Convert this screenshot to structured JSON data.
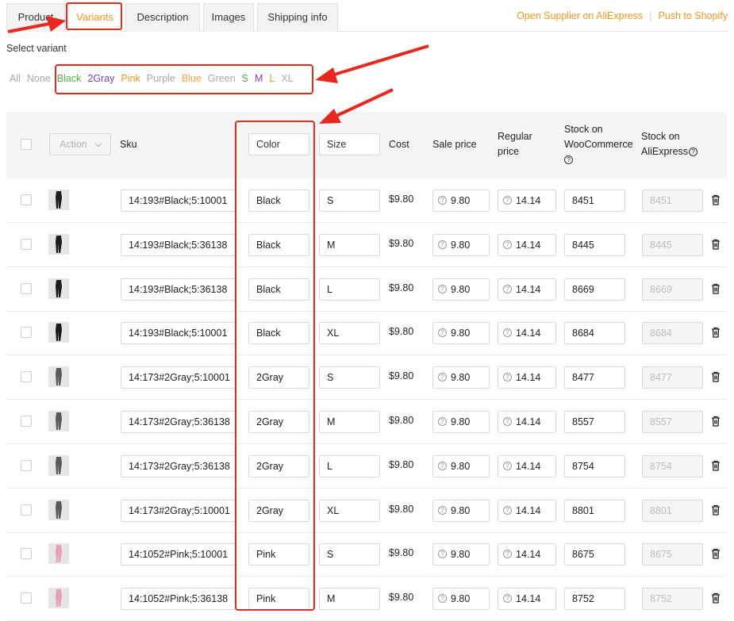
{
  "tabs": [
    {
      "label": "Product",
      "active": false
    },
    {
      "label": "Variants",
      "active": true
    },
    {
      "label": "Description",
      "active": false
    },
    {
      "label": "Images",
      "active": false
    },
    {
      "label": "Shipping info",
      "active": false
    }
  ],
  "header_links": {
    "open_supplier": "Open Supplier on AliExpress",
    "push": "Push to Shopify"
  },
  "select_variant_label": "Select variant",
  "filters": [
    {
      "label": "All",
      "color": "#a8a8a8"
    },
    {
      "label": "None",
      "color": "#a8a8a8"
    },
    {
      "label": "Black",
      "color": "#52b043"
    },
    {
      "label": "2Gray",
      "color": "#7b3fc4"
    },
    {
      "label": "Pink",
      "color": "#f0961e"
    },
    {
      "label": "Purple",
      "color": "#a8a8a8"
    },
    {
      "label": "Blue",
      "color": "#f0a83c"
    },
    {
      "label": "Green",
      "color": "#a8a8a8"
    },
    {
      "label": "S",
      "color": "#52b043"
    },
    {
      "label": "M",
      "color": "#7b3fc4"
    },
    {
      "label": "L",
      "color": "#f0961e"
    },
    {
      "label": "XL",
      "color": "#a8a8a8"
    }
  ],
  "table": {
    "action_label": "Action",
    "headers": {
      "sku": "Sku",
      "color": "Color",
      "size": "Size",
      "cost": "Cost",
      "sale_price": "Sale price",
      "regular_price_1": "Regular",
      "regular_price_2": "price",
      "stock_woo_1": "Stock on",
      "stock_woo_2": "WooCommerce",
      "stock_ali_1": "Stock on",
      "stock_ali_2": "AliExpress"
    },
    "rows": [
      {
        "sku": "14:193#Black;5:10001",
        "color": "Black",
        "size": "S",
        "cost": "$9.80",
        "sale": "9.80",
        "regular": "14.14",
        "stock_woo": "8451",
        "stock_ali": "8451",
        "thumb": "black"
      },
      {
        "sku": "14:193#Black;5:36138",
        "color": "Black",
        "size": "M",
        "cost": "$9.80",
        "sale": "9.80",
        "regular": "14.14",
        "stock_woo": "8445",
        "stock_ali": "8445",
        "thumb": "black"
      },
      {
        "sku": "14:193#Black;5:36138",
        "color": "Black",
        "size": "L",
        "cost": "$9.80",
        "sale": "9.80",
        "regular": "14.14",
        "stock_woo": "8669",
        "stock_ali": "8669",
        "thumb": "black"
      },
      {
        "sku": "14:193#Black;5:10001",
        "color": "Black",
        "size": "XL",
        "cost": "$9.80",
        "sale": "9.80",
        "regular": "14.14",
        "stock_woo": "8684",
        "stock_ali": "8684",
        "thumb": "black"
      },
      {
        "sku": "14:173#2Gray;5:10001",
        "color": "2Gray",
        "size": "S",
        "cost": "$9.80",
        "sale": "9.80",
        "regular": "14.14",
        "stock_woo": "8477",
        "stock_ali": "8477",
        "thumb": "gray"
      },
      {
        "sku": "14:173#2Gray;5:36138",
        "color": "2Gray",
        "size": "M",
        "cost": "$9.80",
        "sale": "9.80",
        "regular": "14.14",
        "stock_woo": "8557",
        "stock_ali": "8557",
        "thumb": "gray"
      },
      {
        "sku": "14:173#2Gray;5:36138",
        "color": "2Gray",
        "size": "L",
        "cost": "$9.80",
        "sale": "9.80",
        "regular": "14.14",
        "stock_woo": "8754",
        "stock_ali": "8754",
        "thumb": "gray"
      },
      {
        "sku": "14:173#2Gray;5:10001",
        "color": "2Gray",
        "size": "XL",
        "cost": "$9.80",
        "sale": "9.80",
        "regular": "14.14",
        "stock_woo": "8801",
        "stock_ali": "8801",
        "thumb": "gray"
      },
      {
        "sku": "14:1052#Pink;5:10001",
        "color": "Pink",
        "size": "S",
        "cost": "$9.80",
        "sale": "9.80",
        "regular": "14.14",
        "stock_woo": "8675",
        "stock_ali": "8675",
        "thumb": "pink"
      },
      {
        "sku": "14:1052#Pink;5:36138",
        "color": "Pink",
        "size": "M",
        "cost": "$9.80",
        "sale": "9.80",
        "regular": "14.14",
        "stock_woo": "8752",
        "stock_ali": "8752",
        "thumb": "pink"
      }
    ]
  },
  "annotation_color": "#e8281f",
  "accent_color": "#f0961e"
}
